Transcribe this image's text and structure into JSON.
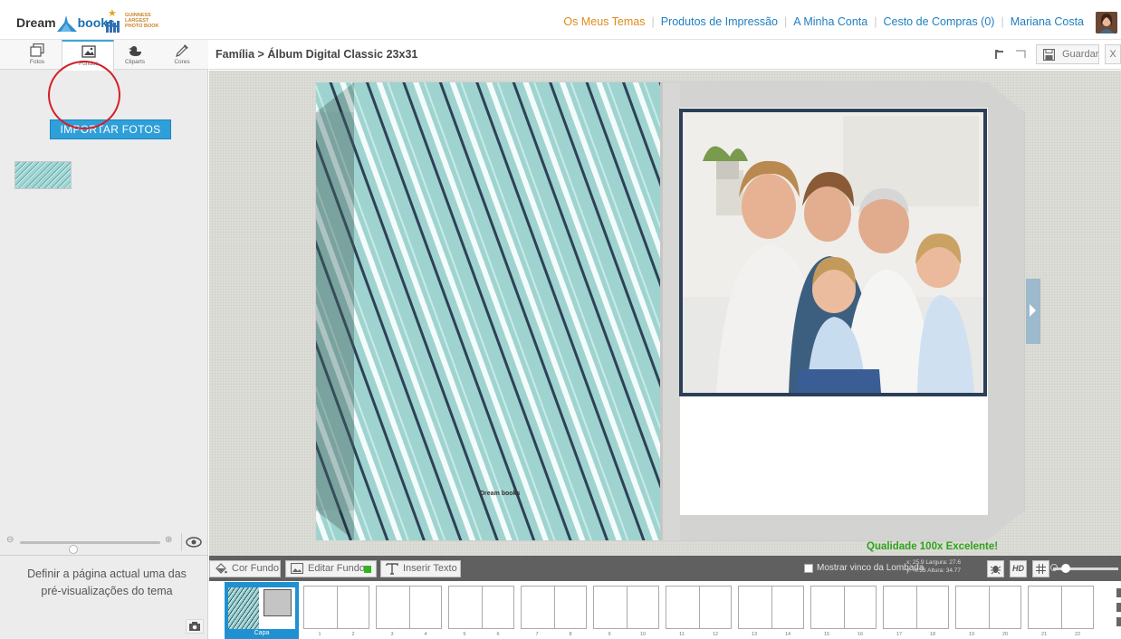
{
  "app": {
    "logo_part1": "Dream",
    "logo_part2": "books.",
    "guinness_text": [
      "GUINNESS",
      "LARGEST",
      "PHOTO BOOK"
    ]
  },
  "topnav": {
    "items": [
      {
        "label": "Os Meus Temas",
        "active": true
      },
      {
        "label": "Produtos de Impressão",
        "active": false
      },
      {
        "label": "A Minha Conta",
        "active": false
      },
      {
        "label": "Cesto de Compras (0)",
        "active": false
      },
      {
        "label": "Mariana Costa",
        "active": false
      }
    ],
    "separator": "|"
  },
  "tabs": [
    {
      "label": "Fotos",
      "icon": "photos-icon"
    },
    {
      "label": "Fundos",
      "icon": "image-icon",
      "active": true
    },
    {
      "label": "Cliparts",
      "icon": "clipart-duck-icon"
    },
    {
      "label": "Cores",
      "icon": "eyedropper-icon"
    }
  ],
  "sidebar": {
    "import_button": "IMPORTAR FOTOS",
    "hint_line1": "Definir a página actual uma das",
    "hint_line2": "pré-visualizações do tema",
    "zoom_minus": "⊖",
    "zoom_plus": "⊕",
    "zoom_level": 0.37
  },
  "breadcrumb": "Família > Álbum Digital Classic 23x31",
  "toolbar": {
    "save_label": "Guardar",
    "close_label": "X"
  },
  "canvas": {
    "quality_label": "Qualidade 100x Excelente!",
    "book_logo": "Dream books"
  },
  "bottom_toolbar": {
    "cor_fundo": "Cor Fundo",
    "editar_fundo": "Editar Fundo",
    "inserir_texto": "Inserir Texto",
    "spine_label": "Mostrar vinco da Lombada",
    "coords_line1": "x: 25.9   Largura: 27.6",
    "coords_line2": "y: -0.33  Altura: 34.77",
    "hd_label": "HD"
  },
  "pagestrip": {
    "cover_label": "Capa",
    "page_numbers": [
      "1",
      "2",
      "3",
      "4",
      "5",
      "6",
      "7",
      "8",
      "9",
      "10",
      "11",
      "12",
      "13",
      "14",
      "15",
      "16",
      "17",
      "18",
      "19",
      "20",
      "21",
      "22"
    ]
  },
  "colors": {
    "accent": "#2e9fd9",
    "nav_active": "#e08a1b",
    "nav_link": "#1f7fc0",
    "quality_green": "#2ea41a",
    "highlight_red": "#d61f26"
  }
}
